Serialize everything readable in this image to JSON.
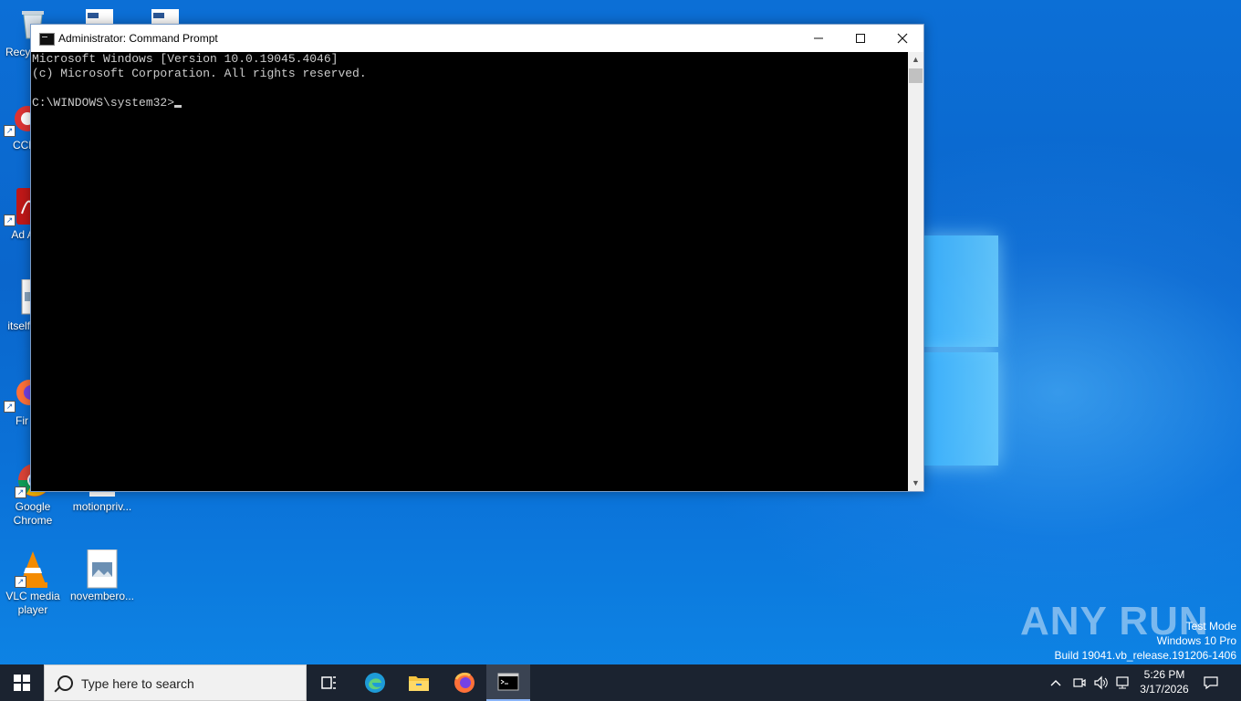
{
  "window": {
    "title": "Administrator: Command Prompt",
    "minimize": "—",
    "maximize": "☐",
    "close": "✕"
  },
  "console": {
    "lines": [
      "Microsoft Windows [Version 10.0.19045.4046]",
      "(c) Microsoft Corporation. All rights reserved.",
      "",
      "C:\\WINDOWS\\system32>"
    ]
  },
  "desktop": {
    "icons": [
      {
        "label": "Recy",
        "icon": "recycle-bin-icon"
      },
      {
        "label": "CCl",
        "icon": "ccleaner-icon"
      },
      {
        "label": "Ad Acr",
        "icon": "acrobat-icon"
      },
      {
        "label": "itselfe",
        "icon": "image-file-icon"
      },
      {
        "label": "Fir",
        "icon": "firefox-icon"
      },
      {
        "label": "Google Chrome",
        "icon": "chrome-icon"
      },
      {
        "label": "motionpriv...",
        "icon": "file-icon"
      },
      {
        "label": "VLC media player",
        "icon": "vlc-icon"
      },
      {
        "label": "novembero...",
        "icon": "image-file-icon"
      }
    ]
  },
  "watermark": {
    "text": "ANY RUN",
    "test_mode": "Test Mode",
    "edition": "Windows 10 Pro",
    "build": "Build 19041.vb_release.191206-1406"
  },
  "taskbar": {
    "search_placeholder": "Type here to search",
    "time": "5:26 PM",
    "date": "3/17/2026"
  },
  "colors": {
    "desktop": "#0a66cc",
    "taskbar": "#1b2330",
    "console_bg": "#000000",
    "console_fg": "#cccccc"
  }
}
